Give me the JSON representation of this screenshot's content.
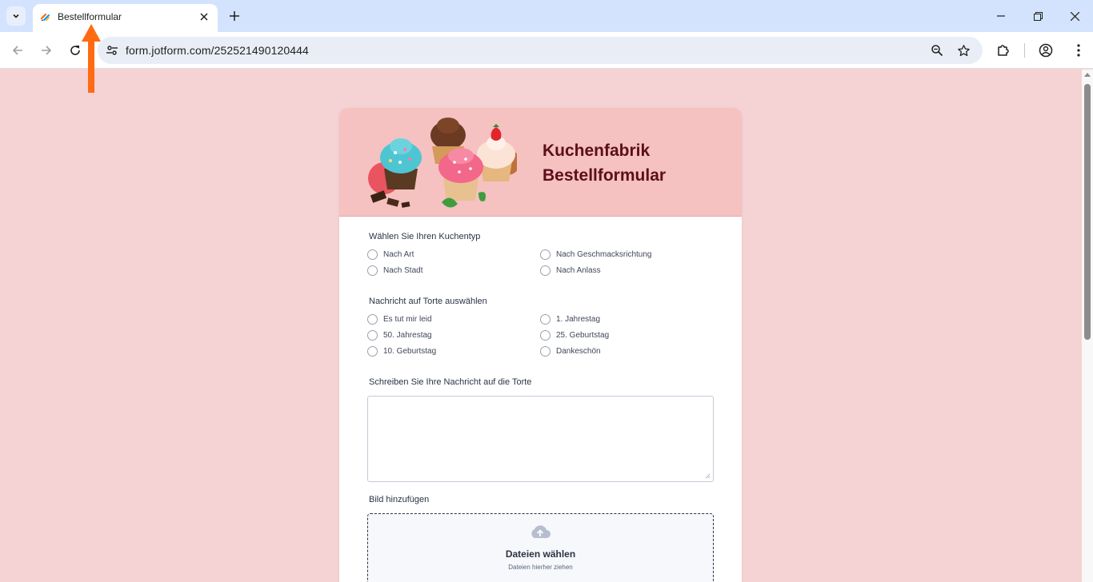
{
  "browser": {
    "tab_title": "Bestellformular",
    "url": "form.jotform.com/252521490120444"
  },
  "form": {
    "title_line1": "Kuchenfabrik",
    "title_line2": "Bestellformular",
    "q1": {
      "label": "Wählen Sie Ihren Kuchentyp",
      "options": [
        "Nach Art",
        "Nach Geschmacksrichtung",
        "Nach Stadt",
        "Nach Anlass"
      ]
    },
    "q2": {
      "label": "Nachricht auf Torte auswählen",
      "options": [
        "Es tut mir leid",
        "1. Jahrestag",
        "50. Jahrestag",
        "25. Geburtstag",
        "10. Geburtstag",
        "Dankeschön"
      ]
    },
    "q3": {
      "label": "Schreiben Sie Ihre Nachricht auf die Torte",
      "value": ""
    },
    "q4": {
      "label": "Bild hinzufügen",
      "button": "Dateien wählen",
      "hint": "Dateien hierher ziehen"
    }
  },
  "colors": {
    "page_bg": "#f5d2d3",
    "header_bg": "#f5c1c1",
    "title": "#5c0f1a",
    "annotation_arrow": "#ff6a13"
  }
}
